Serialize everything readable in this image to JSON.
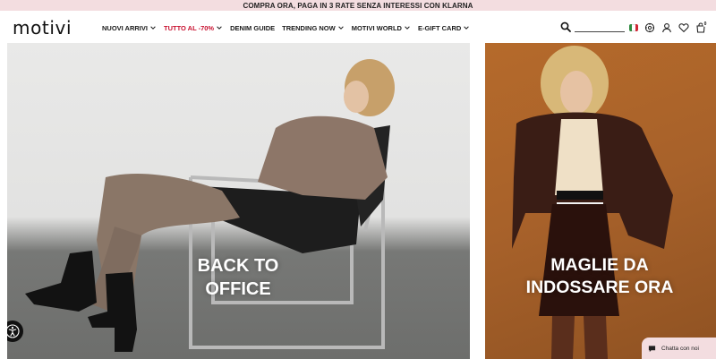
{
  "promo": {
    "text": "COMPRA ORA, PAGA IN 3 RATE SENZA INTERESSI CON KLARNA"
  },
  "header": {
    "logo": "motivi",
    "nav": [
      {
        "label": "NUOVI ARRIVI",
        "has_dropdown": true,
        "sale": false
      },
      {
        "label": "TUTTO AL -70%",
        "has_dropdown": true,
        "sale": true
      },
      {
        "label": "DENIM GUIDE",
        "has_dropdown": false,
        "sale": false
      },
      {
        "label": "TRENDING NOW",
        "has_dropdown": true,
        "sale": false
      },
      {
        "label": "MOTIVI WORLD",
        "has_dropdown": true,
        "sale": false
      },
      {
        "label": "E-GIFT CARD",
        "has_dropdown": true,
        "sale": false
      }
    ],
    "search": {
      "value": "",
      "placeholder": ""
    },
    "icons": [
      "search-icon",
      "italy-flag-icon",
      "store-locator-icon",
      "user-icon",
      "heart-icon",
      "bag-icon"
    ],
    "cart_count": "0"
  },
  "banners": {
    "left": {
      "caption_line1": "BACK TO",
      "caption_line2": "OFFICE"
    },
    "right": {
      "caption_line1": "MAGLIE DA",
      "caption_line2": "INDOSSARE ORA"
    }
  },
  "chat": {
    "label": "Chatta con noi"
  },
  "colors": {
    "promo_bg": "#f3dde0",
    "sale": "#c8102e",
    "right_banner": "#a7612a"
  }
}
